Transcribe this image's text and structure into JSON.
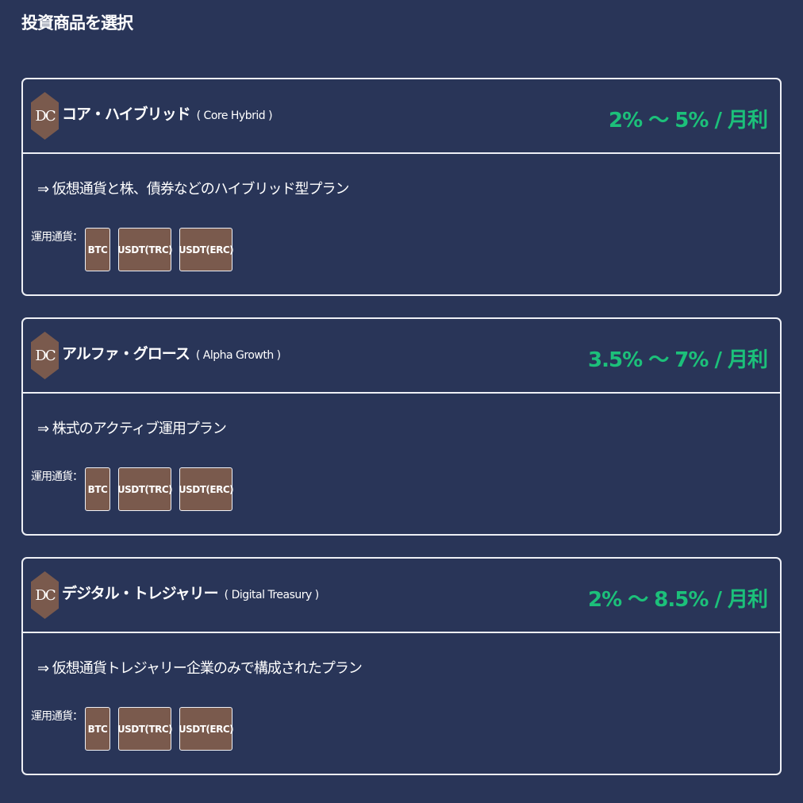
{
  "page": {
    "title": "投資商品を選択"
  },
  "colors": {
    "background": "#293558",
    "rate_green": "#1cc07a",
    "badge_brown": "#7a5a4d",
    "border": "#eef0f6"
  },
  "plans": [
    {
      "logo": "DC",
      "name": "コア・ハイブリッド",
      "name_en": "( Core Hybrid )",
      "rate": "2% ～ 5% / 月利",
      "description": "⇒ 仮想通貨と株、債券などのハイブリッド型プラン",
      "currency_label": "運用通貨：",
      "currencies": [
        "BTC",
        "USDT(TRC)",
        "USDT(ERC)"
      ]
    },
    {
      "logo": "DC",
      "name": "アルファ・グロース",
      "name_en": "( Alpha Growth )",
      "rate": "3.5% ～ 7% / 月利",
      "description": "⇒ 株式のアクティブ運用プラン",
      "currency_label": "運用通貨：",
      "currencies": [
        "BTC",
        "USDT(TRC)",
        "USDT(ERC)"
      ]
    },
    {
      "logo": "DC",
      "name": "デジタル・トレジャリー",
      "name_en": "( Digital Treasury )",
      "rate": "2% ～ 8.5% / 月利",
      "description": "⇒ 仮想通貨トレジャリー企業のみで構成されたプラン",
      "currency_label": "運用通貨：",
      "currencies": [
        "BTC",
        "USDT(TRC)",
        "USDT(ERC)"
      ]
    }
  ]
}
